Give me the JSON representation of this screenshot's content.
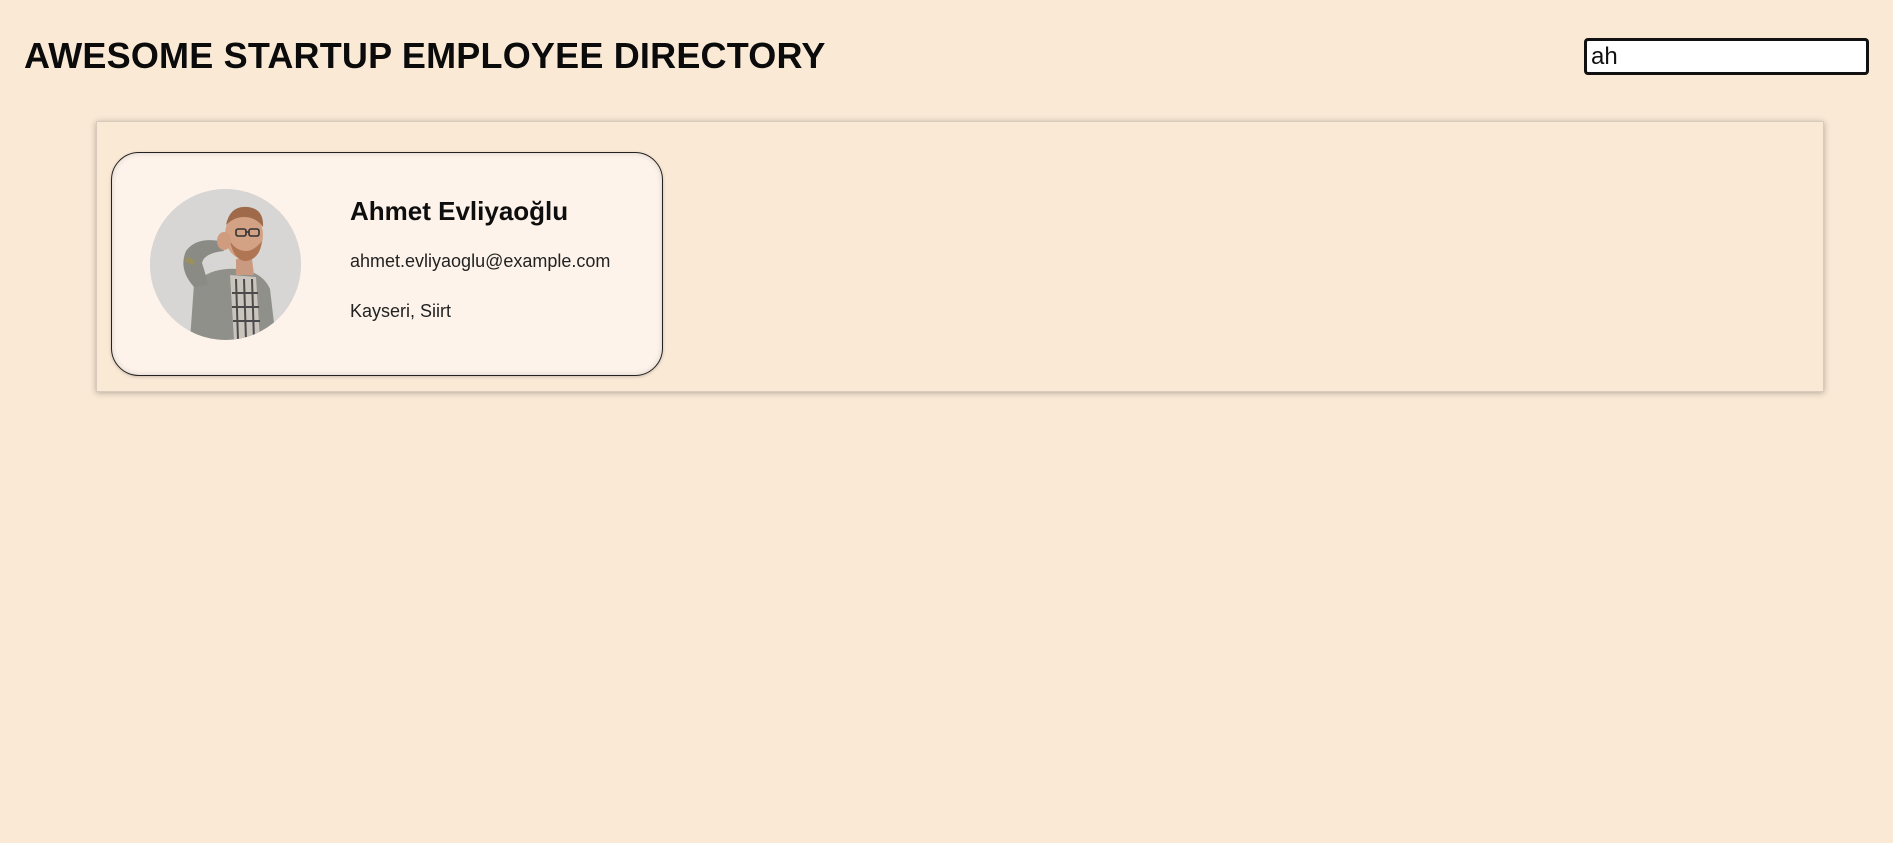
{
  "header": {
    "title": "AWESOME STARTUP EMPLOYEE DIRECTORY"
  },
  "search": {
    "value": "ah",
    "icon": "search-icon"
  },
  "employees": [
    {
      "name": "Ahmet Evliyaoğlu",
      "email": "ahmet.evliyaoglu@example.com",
      "location": "Kayseri, Siirt"
    }
  ]
}
